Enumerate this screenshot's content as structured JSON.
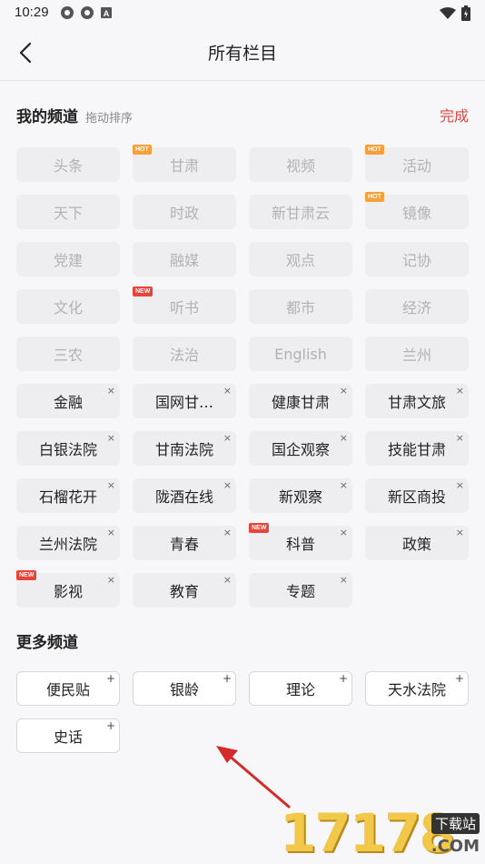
{
  "status": {
    "time": "10:29"
  },
  "header": {
    "title": "所有栏目"
  },
  "my_channels": {
    "title": "我的频道",
    "subtitle": "拖动排序",
    "done_label": "完成",
    "items": [
      {
        "label": "头条",
        "fixed": true,
        "badge": ""
      },
      {
        "label": "甘肃",
        "fixed": true,
        "badge": "HOT"
      },
      {
        "label": "视频",
        "fixed": true,
        "badge": ""
      },
      {
        "label": "活动",
        "fixed": true,
        "badge": "HOT"
      },
      {
        "label": "天下",
        "fixed": true,
        "badge": ""
      },
      {
        "label": "时政",
        "fixed": true,
        "badge": ""
      },
      {
        "label": "新甘肃云",
        "fixed": true,
        "badge": ""
      },
      {
        "label": "镜像",
        "fixed": true,
        "badge": "HOT"
      },
      {
        "label": "党建",
        "fixed": true,
        "badge": ""
      },
      {
        "label": "融媒",
        "fixed": true,
        "badge": ""
      },
      {
        "label": "观点",
        "fixed": true,
        "badge": ""
      },
      {
        "label": "记协",
        "fixed": true,
        "badge": ""
      },
      {
        "label": "文化",
        "fixed": true,
        "badge": ""
      },
      {
        "label": "听书",
        "fixed": true,
        "badge": "NEW"
      },
      {
        "label": "都市",
        "fixed": true,
        "badge": ""
      },
      {
        "label": "经济",
        "fixed": true,
        "badge": ""
      },
      {
        "label": "三农",
        "fixed": true,
        "badge": ""
      },
      {
        "label": "法治",
        "fixed": true,
        "badge": ""
      },
      {
        "label": "English",
        "fixed": true,
        "badge": ""
      },
      {
        "label": "兰州",
        "fixed": true,
        "badge": ""
      },
      {
        "label": "金融",
        "fixed": false,
        "badge": ""
      },
      {
        "label": "国网甘…",
        "fixed": false,
        "badge": ""
      },
      {
        "label": "健康甘肃",
        "fixed": false,
        "badge": ""
      },
      {
        "label": "甘肃文旅",
        "fixed": false,
        "badge": ""
      },
      {
        "label": "白银法院",
        "fixed": false,
        "badge": ""
      },
      {
        "label": "甘南法院",
        "fixed": false,
        "badge": ""
      },
      {
        "label": "国企观察",
        "fixed": false,
        "badge": ""
      },
      {
        "label": "技能甘肃",
        "fixed": false,
        "badge": ""
      },
      {
        "label": "石榴花开",
        "fixed": false,
        "badge": ""
      },
      {
        "label": "陇酒在线",
        "fixed": false,
        "badge": ""
      },
      {
        "label": "新观察",
        "fixed": false,
        "badge": ""
      },
      {
        "label": "新区商投",
        "fixed": false,
        "badge": ""
      },
      {
        "label": "兰州法院",
        "fixed": false,
        "badge": ""
      },
      {
        "label": "青春",
        "fixed": false,
        "badge": ""
      },
      {
        "label": "科普",
        "fixed": false,
        "badge": "NEW"
      },
      {
        "label": "政策",
        "fixed": false,
        "badge": ""
      },
      {
        "label": "影视",
        "fixed": false,
        "badge": "NEW"
      },
      {
        "label": "教育",
        "fixed": false,
        "badge": ""
      },
      {
        "label": "专题",
        "fixed": false,
        "badge": ""
      }
    ]
  },
  "more_channels": {
    "title": "更多频道",
    "items": [
      "便民贴",
      "银龄",
      "理论",
      "天水法院",
      "史话"
    ]
  },
  "watermark": {
    "text": "17178",
    "sub": "下载站",
    "com": ".COM"
  },
  "colors": {
    "accent": "#e8443a",
    "hot": "#f5a03a",
    "new": "#e8443a"
  }
}
